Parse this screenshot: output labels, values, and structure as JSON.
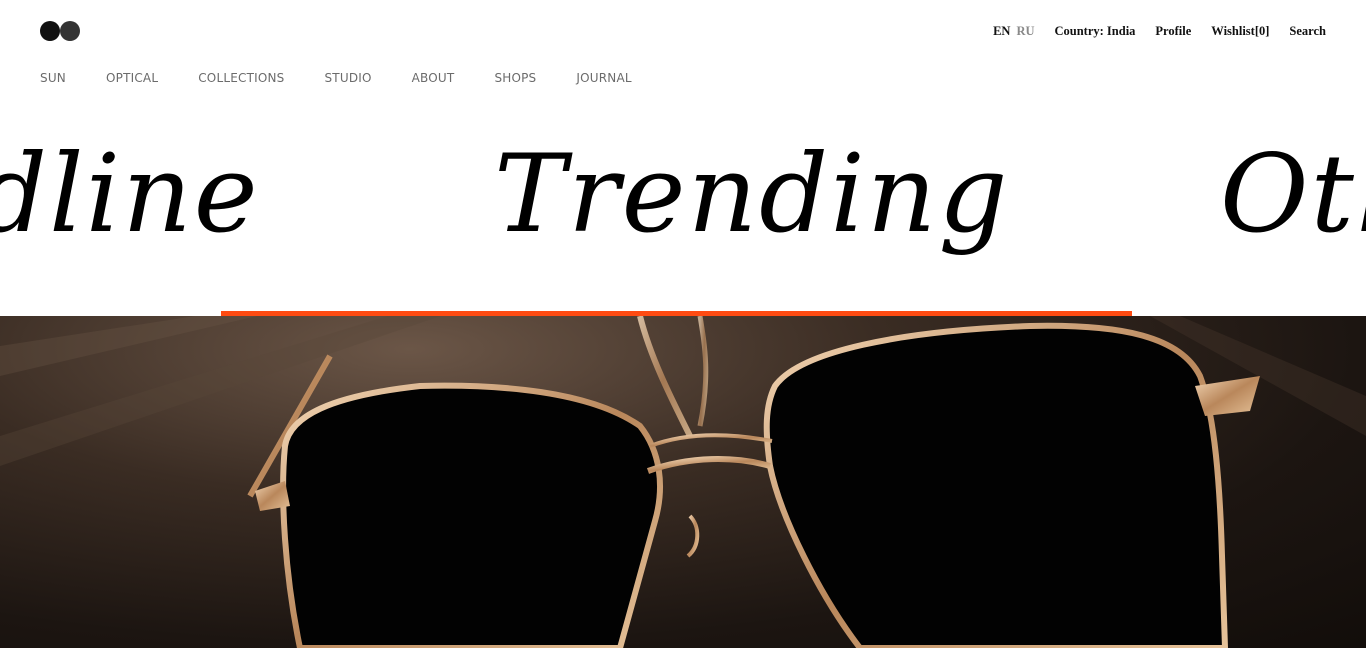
{
  "header": {
    "logo_name": "brand-logo",
    "languages": {
      "active": "EN",
      "inactive": "RU"
    },
    "utility": {
      "country": "Country: India",
      "profile": "Profile",
      "wishlist": "Wishlist[0]",
      "search": "Search"
    }
  },
  "nav": {
    "items": [
      {
        "label": "SUN"
      },
      {
        "label": "OPTICAL"
      },
      {
        "label": "COLLECTIONS"
      },
      {
        "label": "STUDIO"
      },
      {
        "label": "ABOUT"
      },
      {
        "label": "SHOPS"
      },
      {
        "label": "JOURNAL"
      }
    ]
  },
  "carousel": {
    "prev_word": "dline",
    "current_word": "Trending",
    "next_word": "Oth",
    "indicator_color": "#ff4b12"
  },
  "hero": {
    "image_subject": "sunglasses"
  }
}
